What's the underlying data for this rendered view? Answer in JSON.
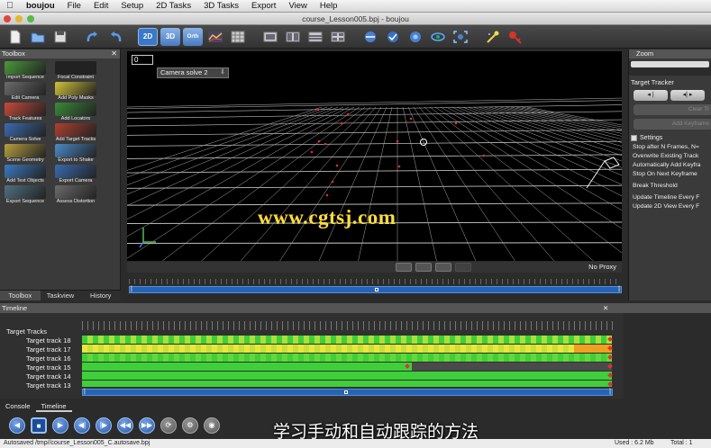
{
  "menubar": {
    "app": "boujou",
    "items": [
      "File",
      "Edit",
      "Setup",
      "2D Tasks",
      "3D Tasks",
      "Export",
      "View",
      "Help"
    ]
  },
  "window": {
    "title": "course_Lesson005.bpj - boujou"
  },
  "toolbar": {
    "btn_2d": "2D",
    "btn_3d": "3D",
    "btn_orth": "Orth"
  },
  "toolbox": {
    "title": "Toolbox",
    "tools": [
      {
        "label": "Import Sequence",
        "color": "#4a9a3a"
      },
      {
        "label": "Focal Constraint",
        "color": "#222222"
      },
      {
        "label": "Edit Camera",
        "color": "#6b6b6b"
      },
      {
        "label": "Add Poly Masks",
        "color": "#d2c23a"
      },
      {
        "label": "Track Features",
        "color": "#c84a3a"
      },
      {
        "label": "Add Locators",
        "color": "#3a8a3a"
      },
      {
        "label": "Camera Solve",
        "color": "#3a6bb0"
      },
      {
        "label": "Add Target Tracks",
        "color": "#b04030"
      },
      {
        "label": "Scene Geometry",
        "color": "#b8a040"
      },
      {
        "label": "Export to Shake",
        "color": "#4a8ac8"
      },
      {
        "label": "Add Test Objects",
        "color": "#3a7ac0"
      },
      {
        "label": "Export Camera",
        "color": "#3a6ab0"
      },
      {
        "label": "Export Sequence",
        "color": "#507080"
      },
      {
        "label": "Assess Distortion",
        "color": "#6a6a6a"
      }
    ],
    "tabs": [
      "Toolbox",
      "Taskview",
      "History"
    ]
  },
  "viewport": {
    "frame": "0",
    "camera_select": "Camera solve 2",
    "watermark": "www.cgtsj.com",
    "proxy": "No Proxy"
  },
  "rightpanel": {
    "zoom_title": "Zoom",
    "tracker_title": "Target Tracker",
    "btn_prev": "◂ |",
    "btn_next": "◂| ▸",
    "clear_label": "Clear Tr",
    "add_keyframe_label": "Add Keyframe",
    "settings_title": "Settings",
    "settings": [
      "Stop after N Frames, N=",
      "Overwrite Existing Track",
      "Automatically Add Keyfra",
      "Stop On Next Keyframe",
      "Break Threshold",
      "Update Timeline Every F",
      "Update 2D View Every F"
    ]
  },
  "timeline": {
    "title": "Timeline",
    "group_label": "Target Tracks",
    "tracks": [
      "Target track 18",
      "Target track 17",
      "Target track 16",
      "Target track 15",
      "Target track 14",
      "Target track 13"
    ]
  },
  "console_tabs": [
    "Console",
    "Timeline"
  ],
  "subtitle": "学习手动和自动跟踪的方法",
  "status": {
    "left": "Autosaved  /tmp//course_Lesson005_C.autosave.bpj",
    "used": "Used : 6.2 Mb",
    "total": "Total : 1"
  }
}
